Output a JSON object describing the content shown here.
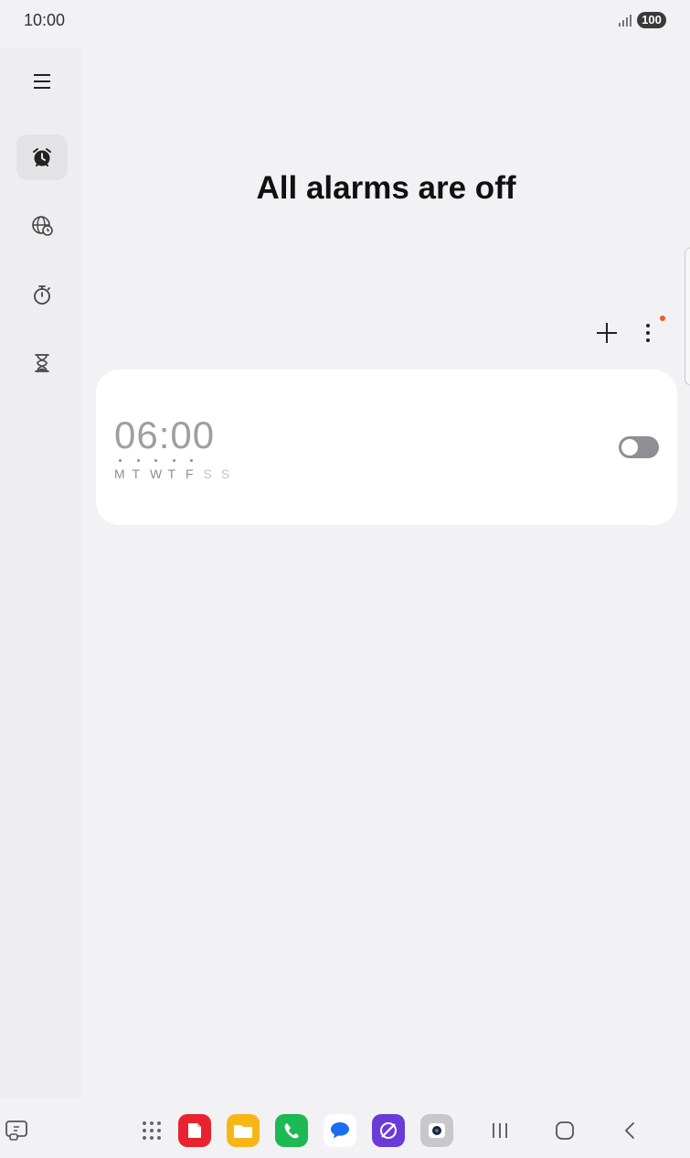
{
  "status_bar": {
    "time": "10:00",
    "battery": "100"
  },
  "nav_rail": {
    "items": [
      {
        "name": "menu",
        "icon": "menu-icon"
      },
      {
        "name": "alarm",
        "icon": "alarm-icon",
        "active": true
      },
      {
        "name": "world-clock",
        "icon": "globe-clock-icon"
      },
      {
        "name": "stopwatch",
        "icon": "stopwatch-icon"
      },
      {
        "name": "timer",
        "icon": "hourglass-icon"
      }
    ]
  },
  "main": {
    "heading": "All alarms are off",
    "alarm": {
      "time": "06:00",
      "enabled": false,
      "days": [
        {
          "label": "M",
          "active": true
        },
        {
          "label": "T",
          "active": true
        },
        {
          "label": "W",
          "active": true
        },
        {
          "label": "T",
          "active": true
        },
        {
          "label": "F",
          "active": true
        },
        {
          "label": "S",
          "active": false
        },
        {
          "label": "S",
          "active": false
        }
      ]
    }
  },
  "colors": {
    "accent_dot": "#f05a28",
    "toggle_off": "#8e8e93",
    "background": "#f2f2f4"
  },
  "taskbar": {
    "apps": [
      "app-drawer-icon",
      "notes-app-icon",
      "files-app-icon",
      "phone-app-icon",
      "messages-app-icon",
      "internet-app-icon",
      "camera-app-icon"
    ],
    "nav": [
      "recents-icon",
      "home-icon",
      "back-icon"
    ]
  }
}
